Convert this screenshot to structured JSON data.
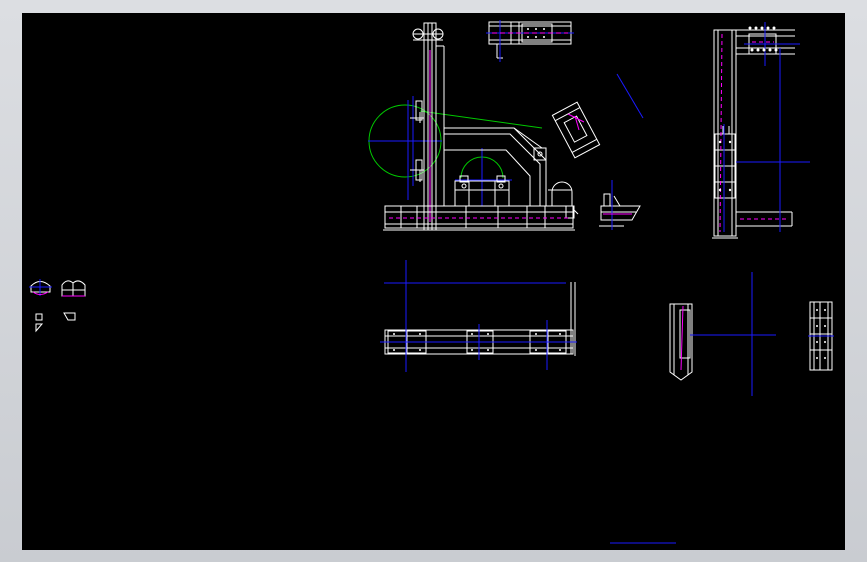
{
  "viewer": {
    "background": "#d2d4d8",
    "canvas_background": "#000000"
  },
  "drawing": {
    "style": "CAD wireframe, dark model space",
    "line_colors": {
      "geometry": "#ffffff",
      "center_lines": "#1a1aff",
      "circles": "#00c800",
      "hidden_lines": "#ff00ff",
      "leader": "#e0e0a0"
    },
    "views": [
      "main-elevation",
      "top-detail",
      "angled-detail",
      "side-bracket",
      "side-elevation",
      "plan-view",
      "small-section",
      "vertical-detail",
      "end-detail",
      "small-icons"
    ]
  }
}
